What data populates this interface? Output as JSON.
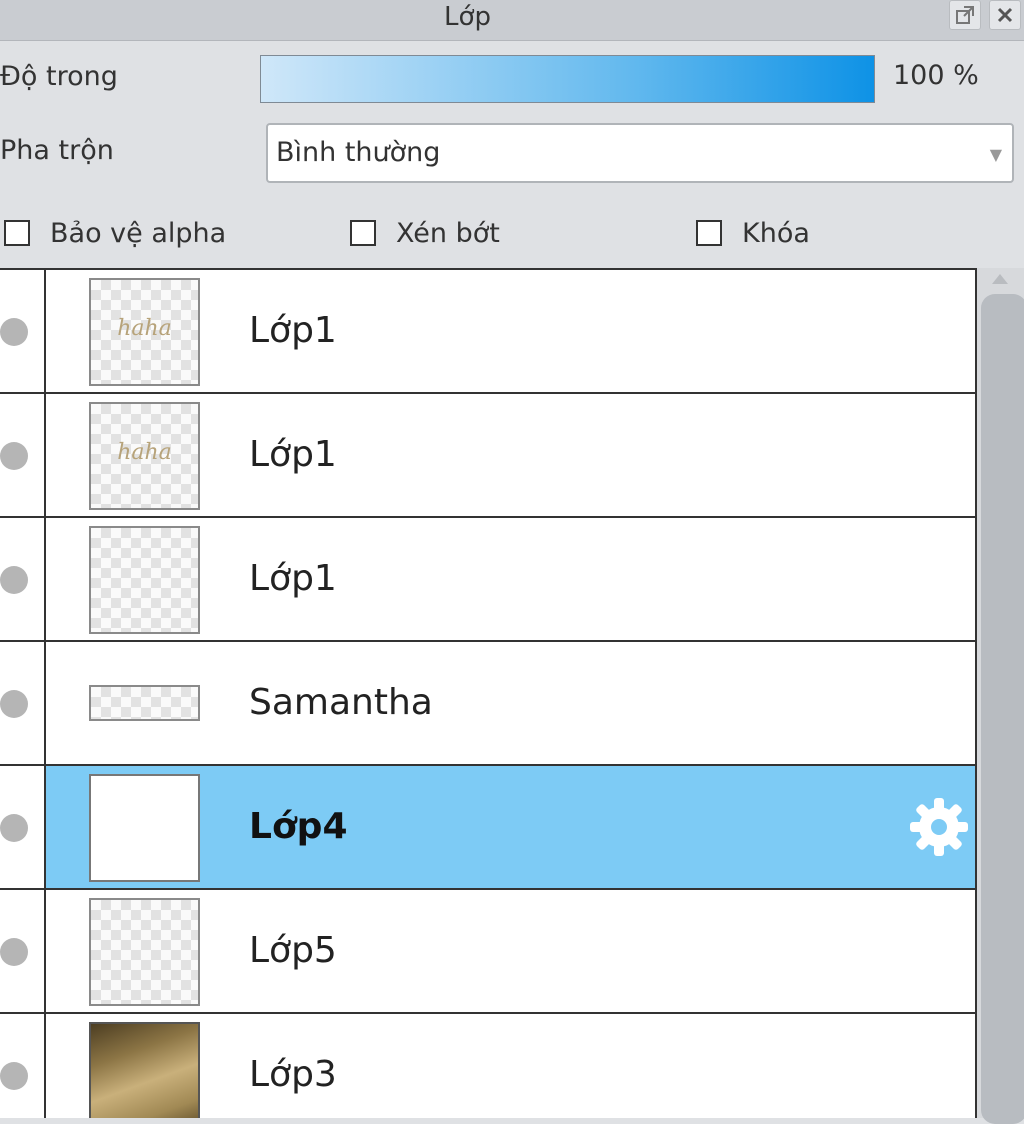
{
  "panel": {
    "title": "Lớp",
    "float_icon": "float-window-icon",
    "close_icon": "close-icon"
  },
  "opacity": {
    "label": "Độ trong",
    "value_text": "100 %",
    "value": 100,
    "bar_colors": [
      "#cfe7f9",
      "#0e92e6"
    ]
  },
  "blend": {
    "label": "Pha trộn",
    "selected": "Bình thường"
  },
  "options": [
    {
      "label": "Bảo vệ alpha",
      "checked": false
    },
    {
      "label": "Xén bớt",
      "checked": false
    },
    {
      "label": "Khóa",
      "checked": false
    }
  ],
  "layers": [
    {
      "name": "Lớp1",
      "thumb": "haha",
      "selected": false
    },
    {
      "name": "Lớp1",
      "thumb": "haha",
      "selected": false
    },
    {
      "name": "Lớp1",
      "thumb": "transparent",
      "selected": false
    },
    {
      "name": "Samantha",
      "thumb": "transparent-wide",
      "selected": false
    },
    {
      "name": "Lớp4",
      "thumb": "white",
      "selected": true,
      "icon": "gear-icon"
    },
    {
      "name": "Lớp5",
      "thumb": "transparent",
      "selected": false
    },
    {
      "name": "Lớp3",
      "thumb": "photo",
      "selected": false
    }
  ],
  "thumb_text": "haha",
  "colors": {
    "selected_row": "#7dcbf5",
    "visibility_dot": "#b5b5b5"
  }
}
